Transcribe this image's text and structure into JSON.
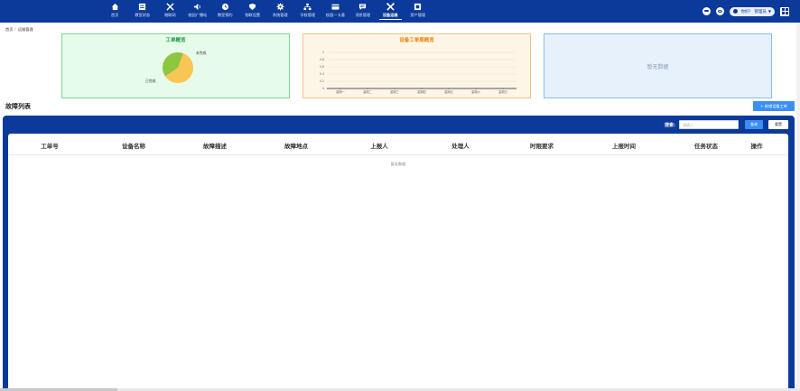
{
  "nav": {
    "items": [
      {
        "label": "首页",
        "icon": "home-icon"
      },
      {
        "label": "教室状态",
        "icon": "classroom-icon"
      },
      {
        "label": "物联网",
        "icon": "tools-icon"
      },
      {
        "label": "校园广播站",
        "icon": "speaker-icon"
      },
      {
        "label": "教室预约",
        "icon": "clock-icon"
      },
      {
        "label": "物联设置",
        "icon": "shield-icon"
      },
      {
        "label": "系统管理",
        "icon": "gear-icon"
      },
      {
        "label": "学校管理",
        "icon": "org-icon"
      },
      {
        "label": "校园一卡通",
        "icon": "card-icon"
      },
      {
        "label": "消息管理",
        "icon": "message-icon"
      },
      {
        "label": "设备运维",
        "icon": "wrench-icon",
        "active": true
      },
      {
        "label": "资产管理",
        "icon": "asset-icon"
      }
    ],
    "user_label": "你好！ 管理员"
  },
  "breadcrumb": {
    "home": "首页",
    "current": "运维管理"
  },
  "panels": {
    "work_order": {
      "title": "工单概览",
      "pie": {
        "slices": [
          {
            "name": "未完成",
            "value": 60,
            "color": "#f9c554"
          },
          {
            "name": "已完成",
            "value": 40,
            "color": "#8ec63f"
          }
        ]
      }
    },
    "trend": {
      "title": "设备工单周概览"
    },
    "empty": {
      "text": "暂无数据"
    }
  },
  "chart_data": {
    "type": "line",
    "title": "设备工单周概览",
    "categories": [
      "星期一",
      "星期二",
      "星期三",
      "星期四",
      "星期五",
      "星期六",
      "星期日"
    ],
    "series": [
      {
        "values": [
          0,
          0,
          0,
          0,
          0,
          0,
          0
        ]
      }
    ],
    "ylim": [
      0,
      1
    ],
    "yticks": [
      "0",
      "0.2",
      "0.4",
      "0.6",
      "0.8",
      "1"
    ],
    "grid": true
  },
  "list": {
    "title": "故障列表",
    "add_button": "+ 新增设备工单",
    "search_label": "搜索:",
    "search_placeholder": "请输入",
    "search_button": "查询",
    "reset_button": "重置",
    "columns": [
      "工单号",
      "设备名称",
      "故障描述",
      "故障地点",
      "上报人",
      "处理人",
      "时限要求",
      "上报时间",
      "任务状态",
      "操作"
    ],
    "empty_text": "暂无数据"
  },
  "colors": {
    "primary": "#0b3a9a",
    "accent": "#3c8ef5"
  }
}
